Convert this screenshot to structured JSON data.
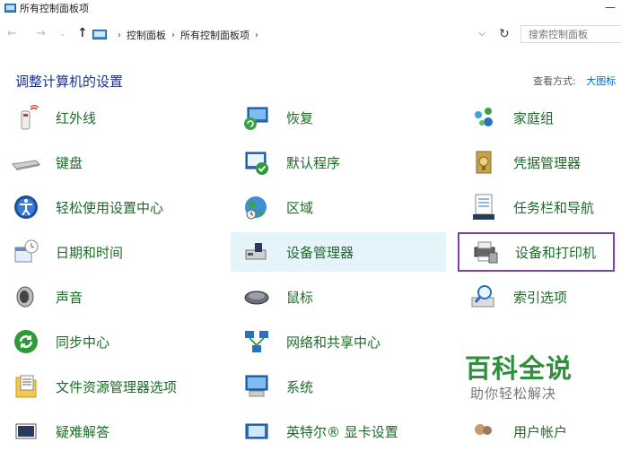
{
  "window": {
    "title": "所有控制面板项",
    "minimize_glyph": "—"
  },
  "address": {
    "crumbs": [
      "控制面板",
      "所有控制面板项"
    ],
    "search_placeholder": "搜索控制面板"
  },
  "header": {
    "title": "调整计算机的设置",
    "view_by_label": "查看方式:",
    "view_by_value": "大图标"
  },
  "items": [
    {
      "label": "红外线",
      "icon": "infrared-icon"
    },
    {
      "label": "恢复",
      "icon": "recovery-icon"
    },
    {
      "label": "家庭组",
      "icon": "homegroup-icon"
    },
    {
      "label": "键盘",
      "icon": "keyboard-icon"
    },
    {
      "label": "默认程序",
      "icon": "default-programs-icon"
    },
    {
      "label": "凭据管理器",
      "icon": "credential-manager-icon"
    },
    {
      "label": "轻松使用设置中心",
      "icon": "ease-of-access-icon"
    },
    {
      "label": "区域",
      "icon": "region-icon"
    },
    {
      "label": "任务栏和导航",
      "icon": "taskbar-icon"
    },
    {
      "label": "日期和时间",
      "icon": "date-time-icon"
    },
    {
      "label": "设备管理器",
      "icon": "device-manager-icon"
    },
    {
      "label": "设备和打印机",
      "icon": "devices-printers-icon"
    },
    {
      "label": "声音",
      "icon": "sound-icon"
    },
    {
      "label": "鼠标",
      "icon": "mouse-icon"
    },
    {
      "label": "索引选项",
      "icon": "indexing-options-icon"
    },
    {
      "label": "同步中心",
      "icon": "sync-center-icon"
    },
    {
      "label": "网络和共享中心",
      "icon": "network-sharing-icon"
    },
    {
      "label": "",
      "icon": ""
    },
    {
      "label": "文件资源管理器选项",
      "icon": "file-explorer-options-icon"
    },
    {
      "label": "系统",
      "icon": "system-icon"
    },
    {
      "label": "",
      "icon": ""
    },
    {
      "label": "疑难解答",
      "icon": "troubleshooting-icon"
    },
    {
      "label": "英特尔® 显卡设置",
      "icon": "intel-graphics-icon"
    },
    {
      "label": "用户帐户",
      "icon": "user-accounts-icon"
    }
  ],
  "watermark": {
    "title": "百科全说",
    "subtitle": "助你轻松解决"
  },
  "colors": {
    "link_green": "#1d6b27",
    "header_blue": "#1e3287",
    "selection_purple": "#7b40b8",
    "hover_blue": "#e5f3fb"
  }
}
